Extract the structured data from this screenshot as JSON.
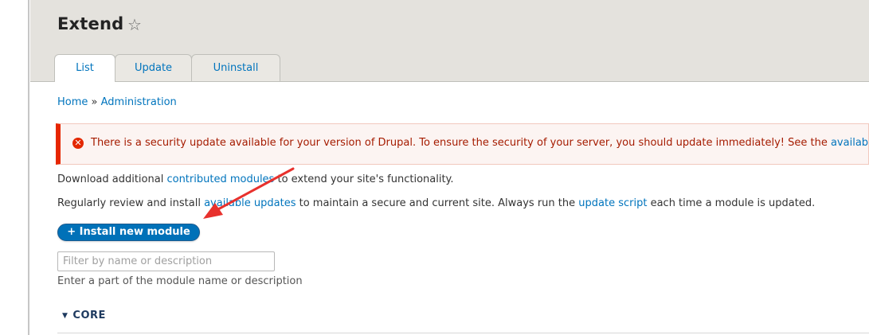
{
  "page": {
    "title": "Extend",
    "star_icon": "star-outline-icon"
  },
  "tabs": [
    {
      "label": "List",
      "active": true
    },
    {
      "label": "Update",
      "active": false
    },
    {
      "label": "Uninstall",
      "active": false
    }
  ],
  "breadcrumb": {
    "home": "Home",
    "separator": "»",
    "admin": "Administration"
  },
  "alert": {
    "icon": "error-icon",
    "text": "There is a security update available for your version of Drupal. To ensure the security of your server, you should update immediately! See the",
    "link": "availab",
    "color": "#e62600"
  },
  "intro": {
    "line1_pre": "Download additional",
    "line1_link": "contributed modules",
    "line1_post": "to extend your site's functionality.",
    "line2_pre": "Regularly review and install",
    "line2_link1": "available updates",
    "line2_mid": "to maintain a secure and current site. Always run the",
    "line2_link2": "update script",
    "line2_post": "each time a module is updated."
  },
  "install_button": {
    "label": "+ Install new module",
    "color": "#0071b8"
  },
  "filter": {
    "placeholder": "Filter by name or description",
    "value": "",
    "help": "Enter a part of the module name or description"
  },
  "section": {
    "label": "CORE",
    "arrow": "▼"
  },
  "annotation": {
    "type": "red-arrow",
    "color": "#e8312d"
  }
}
